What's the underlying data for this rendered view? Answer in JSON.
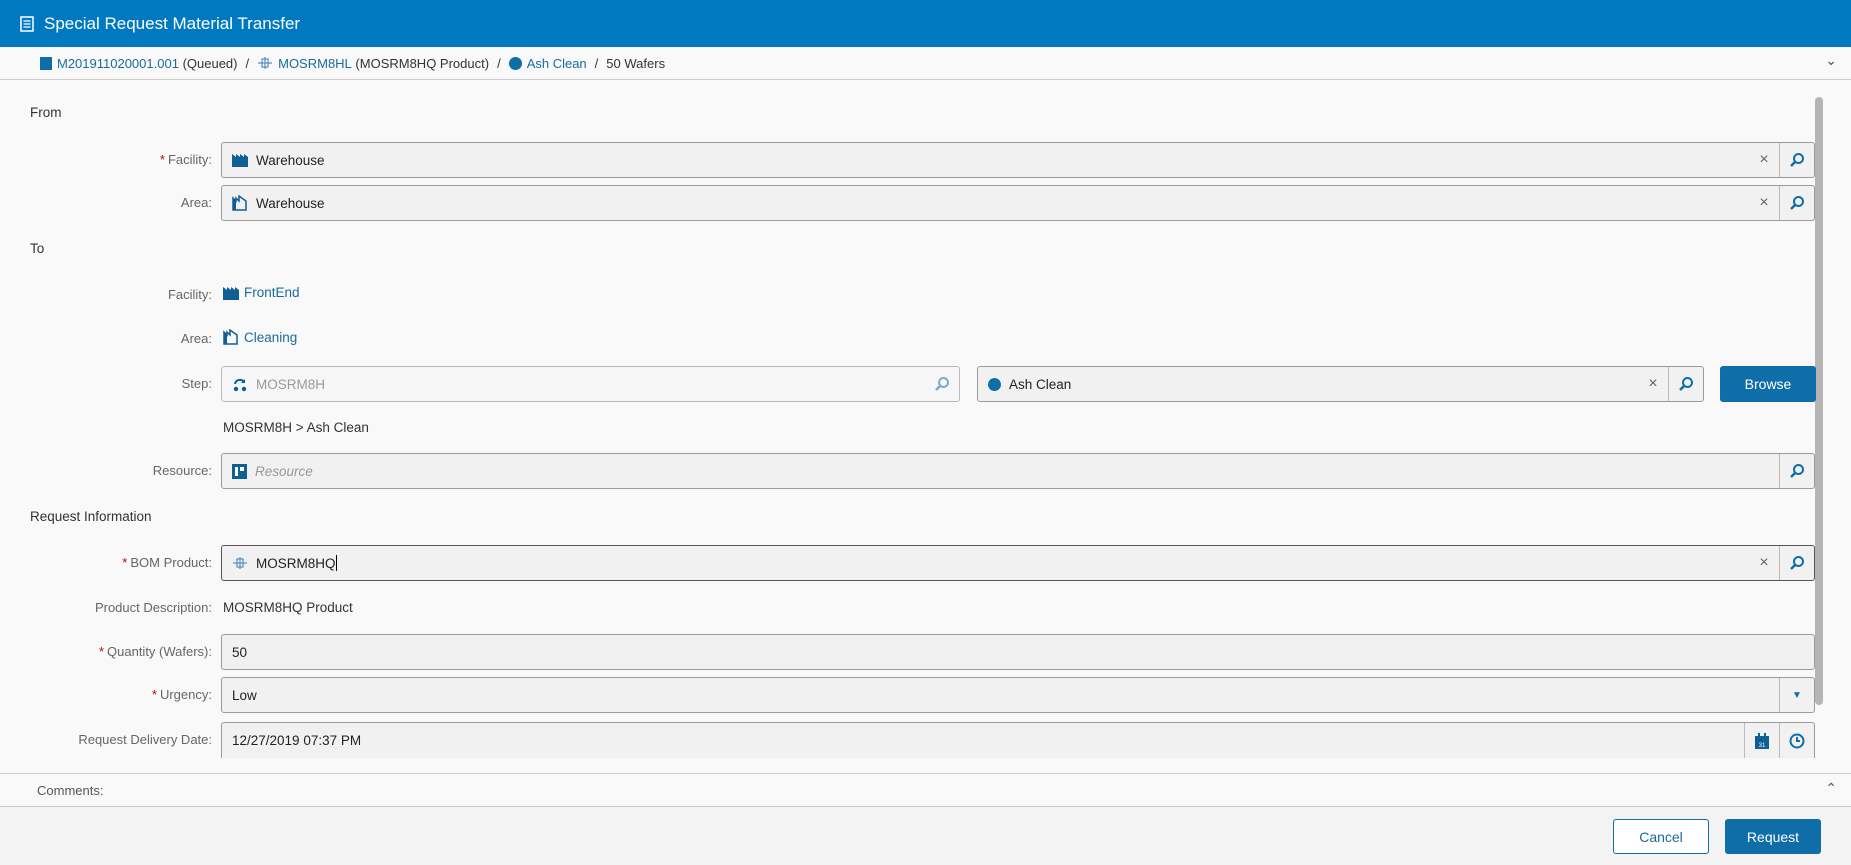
{
  "title": "Special Request Material Transfer",
  "breadcrumb": {
    "material": "M201911020001.001",
    "material_status": "(Queued)",
    "product": "MOSRM8HL",
    "product_desc": "(MOSRM8HQ Product)",
    "step": "Ash Clean",
    "qty": "50",
    "unit": "Wafers",
    "sep": "/"
  },
  "from": {
    "heading": "From",
    "facility_label": "Facility:",
    "facility": "Warehouse",
    "area_label": "Area:",
    "area": "Warehouse"
  },
  "to": {
    "heading": "To",
    "facility_label": "Facility:",
    "facility": "FrontEnd",
    "area_label": "Area:",
    "area": "Cleaning",
    "step_label": "Step:",
    "flow": "MOSRM8H",
    "step": "Ash Clean",
    "browse": "Browse",
    "path": "MOSRM8H > Ash Clean",
    "resource_label": "Resource:",
    "resource_placeholder": "Resource"
  },
  "request": {
    "heading": "Request Information",
    "bom_label": "BOM Product:",
    "bom": "MOSRM8HQ",
    "desc_label": "Product Description:",
    "desc": "MOSRM8HQ Product",
    "qty_label": "Quantity (Wafers):",
    "qty": "50",
    "urgency_label": "Urgency:",
    "urgency": "Low",
    "date_label": "Request Delivery Date:",
    "date": "12/27/2019 07:37 PM",
    "required_mark": "*"
  },
  "comments_label": "Comments:",
  "footer": {
    "cancel": "Cancel",
    "request": "Request"
  },
  "colors": {
    "header": "#0079c1",
    "accent": "#0f6ea8",
    "required": "#cc0000"
  }
}
